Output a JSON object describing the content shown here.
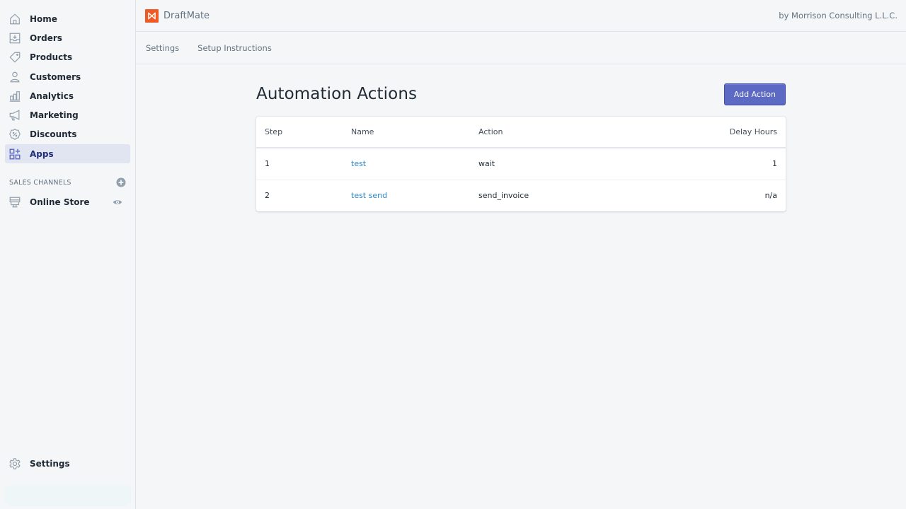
{
  "sidebar": {
    "items": [
      {
        "label": "Home",
        "icon": "home-icon"
      },
      {
        "label": "Orders",
        "icon": "orders-icon"
      },
      {
        "label": "Products",
        "icon": "tag-icon"
      },
      {
        "label": "Customers",
        "icon": "person-icon"
      },
      {
        "label": "Analytics",
        "icon": "bar-chart-icon"
      },
      {
        "label": "Marketing",
        "icon": "megaphone-icon"
      },
      {
        "label": "Discounts",
        "icon": "discount-icon"
      },
      {
        "label": "Apps",
        "icon": "apps-icon",
        "active": true
      }
    ],
    "sales_channels": {
      "header": "SALES CHANNELS",
      "items": [
        {
          "label": "Online Store",
          "icon": "store-icon"
        }
      ]
    },
    "settings_label": "Settings"
  },
  "header": {
    "app_name": "DraftMate",
    "byline": "by Morrison Consulting L.L.C."
  },
  "tabs": [
    {
      "label": "Settings"
    },
    {
      "label": "Setup Instructions"
    }
  ],
  "page": {
    "title": "Automation Actions",
    "add_button": "Add Action"
  },
  "table": {
    "columns": [
      "Step",
      "Name",
      "Action",
      "Delay Hours"
    ],
    "rows": [
      {
        "step": "1",
        "name": "test",
        "action": "wait",
        "delay": "1"
      },
      {
        "step": "2",
        "name": "test send",
        "action": "send_invoice",
        "delay": "n/a"
      }
    ]
  },
  "colors": {
    "accent": "#5c6ac4",
    "logo": "#ef5a24",
    "link": "#2e86c8",
    "active_nav_bg": "#e1e5f1"
  }
}
